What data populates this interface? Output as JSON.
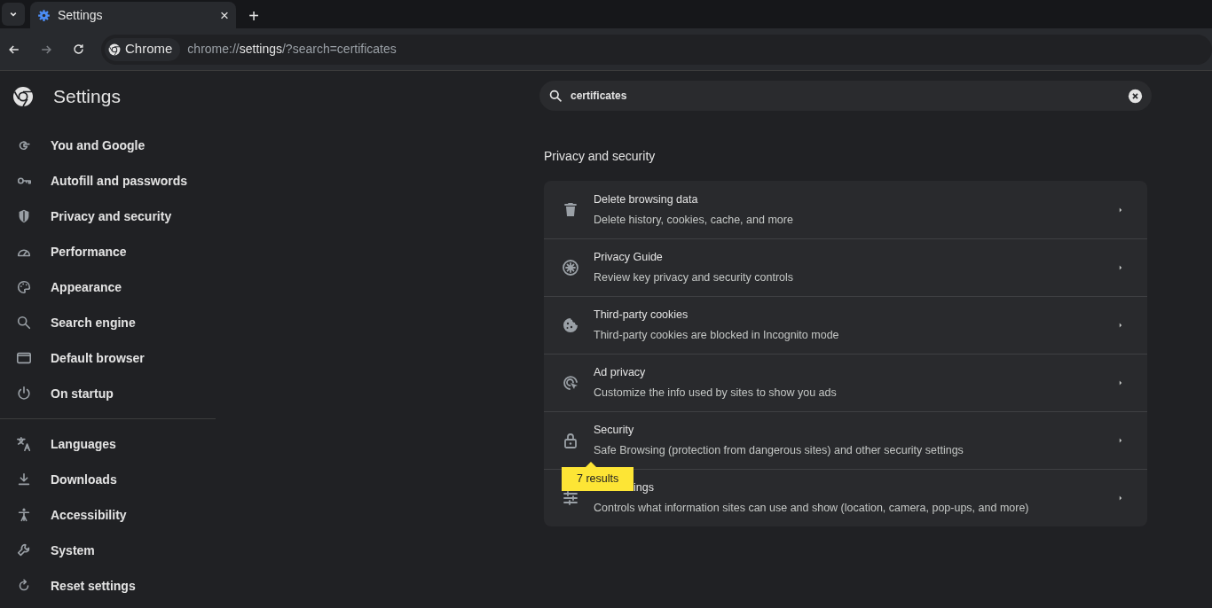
{
  "tab": {
    "title": "Settings",
    "close": "×"
  },
  "new_tab": "+",
  "address_bar": {
    "chip": "Chrome",
    "url_scheme": "chrome://",
    "url_host": "settings",
    "url_path": "/?search=certificates"
  },
  "page_title": "Settings",
  "sidebar": {
    "groups": [
      {
        "items": [
          {
            "label": "You and Google"
          },
          {
            "label": "Autofill and passwords"
          },
          {
            "label": "Privacy and security"
          },
          {
            "label": "Performance"
          },
          {
            "label": "Appearance"
          },
          {
            "label": "Search engine"
          },
          {
            "label": "Default browser"
          },
          {
            "label": "On startup"
          }
        ]
      },
      {
        "items": [
          {
            "label": "Languages"
          },
          {
            "label": "Downloads"
          },
          {
            "label": "Accessibility"
          },
          {
            "label": "System"
          },
          {
            "label": "Reset settings"
          }
        ]
      }
    ]
  },
  "search": {
    "value": "certificates"
  },
  "section": {
    "title": "Privacy and security",
    "rows": [
      {
        "title": "Delete browsing data",
        "subtitle": "Delete history, cookies, cache, and more"
      },
      {
        "title": "Privacy Guide",
        "subtitle": "Review key privacy and security controls"
      },
      {
        "title": "Third-party cookies",
        "subtitle": "Third-party cookies are blocked in Incognito mode"
      },
      {
        "title": "Ad privacy",
        "subtitle": "Customize the info used by sites to show you ads"
      },
      {
        "title": "Security",
        "subtitle": "Safe Browsing (protection from dangerous sites) and other security settings"
      },
      {
        "title": "ings",
        "title_covered": true,
        "subtitle": "Controls what information sites can use and show (location, camera, pop-ups, and more)"
      }
    ]
  },
  "results_bubble": "7 results"
}
